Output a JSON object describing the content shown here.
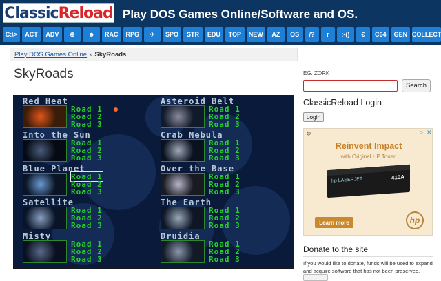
{
  "header": {
    "logo_classic": "Classic",
    "logo_reload": "Reload",
    "site_title": "Play DOS Games Online/Software and OS."
  },
  "nav": {
    "items": [
      "C:\\>",
      "ACT",
      "ADV",
      "⊕",
      "☻",
      "RAC",
      "RPG",
      "✈",
      "SPO",
      "STR",
      "EDU",
      "TOP",
      "NEW",
      "AZ",
      "OS",
      "/?",
      "r",
      ":-()",
      "€",
      "C64",
      "GEN",
      "COLLECT"
    ]
  },
  "breadcrumb": {
    "link": "Play DOS Games Online",
    "separator": "»",
    "current": "SkyRoads"
  },
  "page": {
    "title": "SkyRoads"
  },
  "game": {
    "worlds": [
      {
        "name": "Red Heat",
        "roads": [
          "Road 1",
          "Road 2",
          "Road 3"
        ]
      },
      {
        "name": "Asteroid Belt",
        "roads": [
          "Road 1",
          "Road 2",
          "Road 3"
        ]
      },
      {
        "name": "Into the Sun",
        "roads": [
          "Road 1",
          "Road 2",
          "Road 3"
        ]
      },
      {
        "name": "Crab Nebula",
        "roads": [
          "Road 1",
          "Road 2",
          "Road 3"
        ]
      },
      {
        "name": "Blue Planet",
        "roads": [
          "Road 1",
          "Road 2",
          "Road 3"
        ]
      },
      {
        "name": "Over the Base",
        "roads": [
          "Road 1",
          "Road 2",
          "Road 3"
        ]
      },
      {
        "name": "Satellite",
        "roads": [
          "Road 1",
          "Road 2",
          "Road 3"
        ]
      },
      {
        "name": "The Earth",
        "roads": [
          "Road 1",
          "Road 2",
          "Road 3"
        ]
      },
      {
        "name": "Misty",
        "roads": [
          "Road 1",
          "Road 2",
          "Road 3"
        ]
      },
      {
        "name": "Druidia",
        "roads": [
          "Road 1",
          "Road 2",
          "Road 3"
        ]
      }
    ],
    "selected_world": "Blue Planet",
    "selected_road": "Road 1"
  },
  "sidebar": {
    "search_hint": "EG. ZORK",
    "search_value": "",
    "search_button": "Search",
    "login_heading": "ClassicReload Login",
    "login_button": "Login",
    "donate_heading": "Donate to the site",
    "donate_text": "If you would like to donate, funds will be used to expand and acquire software that has not been preserved."
  },
  "ad": {
    "headline": "Reinvent Impact",
    "subline": "with Original HP Toner.",
    "box_label": "410A",
    "box_brand": "hp LASERJET",
    "cta": "Learn more",
    "brand_mark": "hp"
  },
  "colors": {
    "header_bg": "#0c3562",
    "nav_button": "#1e7fd6",
    "road_text": "#29d329",
    "world_text": "#b9c9d6"
  }
}
